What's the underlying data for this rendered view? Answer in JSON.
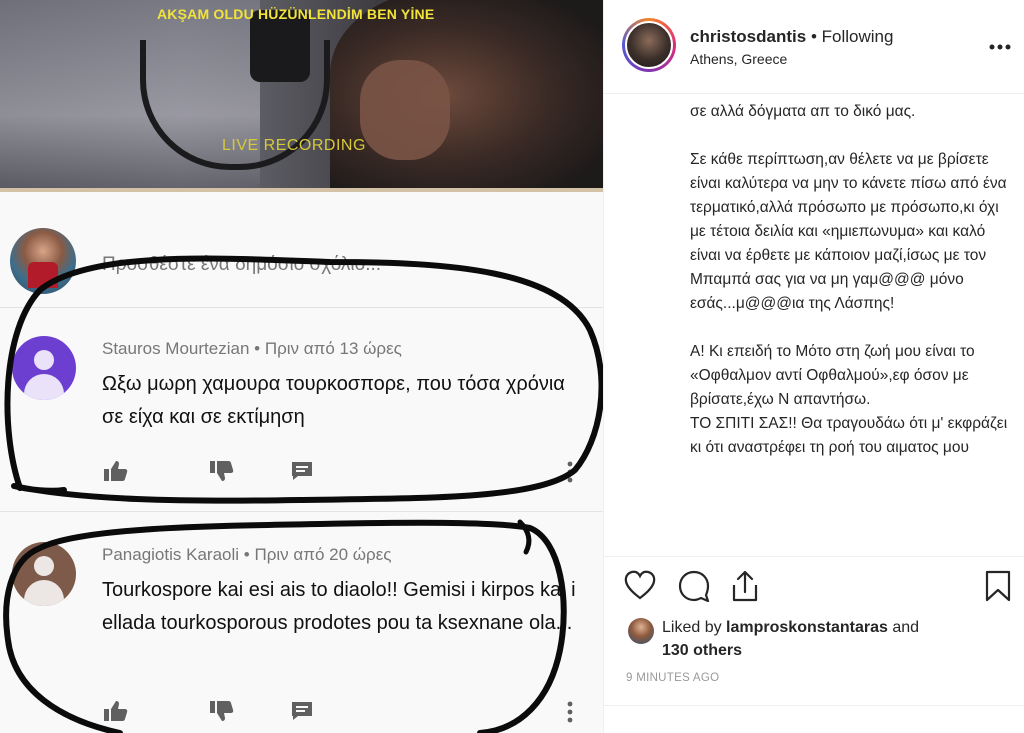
{
  "video": {
    "title": "AKŞAM OLDU HÜZÜNLENDİM BEN YİNE",
    "overlay": "LIVE RECORDING"
  },
  "compose": {
    "placeholder": "Προσθέστε ένα δημόσιο σχόλιο..."
  },
  "comments": [
    {
      "author": "Stauros Mourtezian",
      "time": "Πριν από 13 ώρες",
      "text": "Ωξω μωρη χαμουρα τουρκοσπορε, που τόσα χρόνια σε είχα και σε εκτίμηση"
    },
    {
      "author": "Panagiotis Karaoli",
      "time": "Πριν από 20 ώρες",
      "text": "Tourkospore kai esi ais to diaolo!! Gemisi i kirpos kai i ellada tourkosporous prodotes pou ta ksexnane ola..."
    }
  ],
  "post": {
    "username": "christosdantis",
    "following": "• Following",
    "location": "Athens, Greece",
    "caption": [
      "σε αλλά δόγματα απ το δικό μας.",
      "Σε κάθε περίπτωση,αν θέλετε να με βρίσετε είναι καλύτερα να μην το κάνετε πίσω από ένα τερματικό,αλλά πρόσωπο με πρόσωπο,κι όχι με τέτοια δειλία και «ημιεπωνυμα» και καλό είναι να έρθετε με κάποιον μαζί,ίσως με τον Μπαμπά σας για να μη γαμ@@@ μόνο εσάς...μ@@@ια της Λάσπης!",
      "Α! Κι επειδή το Μότο στη ζωή μου είναι το «Οφθαλμον αντί Οφθαλμού»,εφ όσον με βρίσατε,έχω Ν απαντήσω.",
      "ΤΟ ΣΠΙΤΙ ΣΑΣ!! Θα τραγουδάω ότι μ' εκφράζει κι ότι αναστρέφει τη ροή του αιματος μου"
    ],
    "liked_by_prefix": "Liked by",
    "liked_by_user": "lamproskonstantaras",
    "liked_by_suffix": "and",
    "liked_others": "130 others",
    "time": "9 MINUTES AGO"
  },
  "icons": {
    "like": "heart-icon",
    "comment": "comment-icon",
    "share": "share-icon",
    "save": "bookmark-icon",
    "more": "more-options-icon"
  },
  "colors": {
    "video_title": "#f2e33a",
    "avatar1": "#6c3fd1",
    "avatar2": "#7d5a4a",
    "scribble": "#0b0b0b"
  }
}
